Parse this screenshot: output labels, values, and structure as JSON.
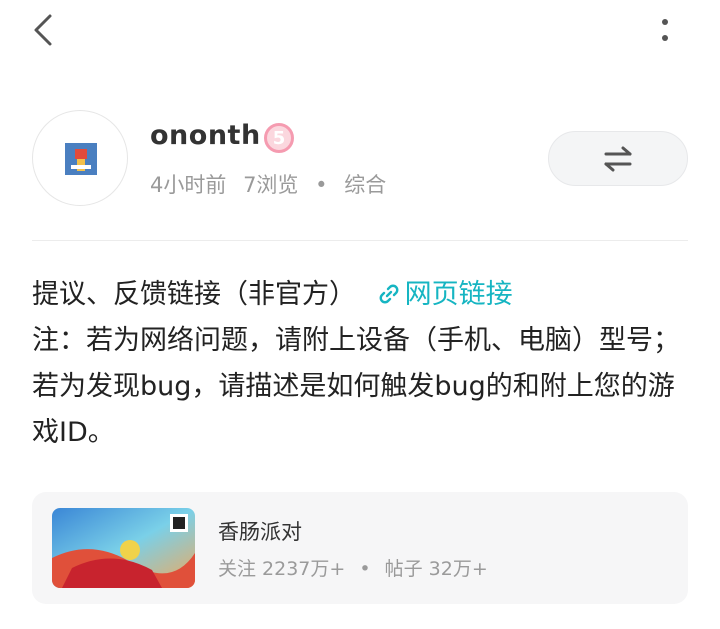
{
  "topbar": {
    "back_icon": "chevron-left-icon",
    "more_icon": "more-vertical-icon"
  },
  "author": {
    "name": "ononth",
    "level": "5",
    "time": "4小时前",
    "views": "7浏览",
    "separator": "•",
    "category": "综合"
  },
  "swap_icon": "swap-icon",
  "post": {
    "line1": "提议、反馈链接（非官方）",
    "link_label": "网页链接",
    "body": "注：若为网络问题，请附上设备（手机、电脑）型号；若为发现bug，请描述是如何触发bug的和附上您的游戏ID。"
  },
  "game": {
    "name": "香肠派对",
    "followers": "关注 2237万+",
    "separator": "•",
    "posts": "帖子 32万+"
  },
  "colors": {
    "link": "#16b5c2",
    "badge": "#f59bb0",
    "muted": "#9a9a9a"
  }
}
